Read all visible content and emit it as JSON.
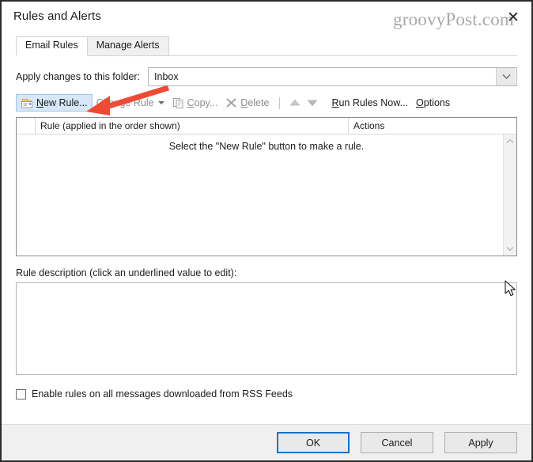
{
  "window": {
    "title": "Rules and Alerts",
    "close_icon": "close-icon",
    "watermark": "groovyPost.com"
  },
  "tabs": [
    {
      "label": "Email Rules",
      "active": true
    },
    {
      "label": "Manage Alerts",
      "active": false
    }
  ],
  "folder": {
    "label": "Apply changes to this folder:",
    "value": "Inbox",
    "dropdown_icon": "chevron-down-icon"
  },
  "toolbar": {
    "new_rule": {
      "label": "New Rule...",
      "icon": "new-rule-icon",
      "highlighted": true
    },
    "change_rule": {
      "label": "Change Rule",
      "icon": "chevron-down-icon",
      "disabled": true
    },
    "copy": {
      "label": "Copy...",
      "icon": "copy-icon",
      "disabled": true
    },
    "delete": {
      "label": "Delete",
      "icon": "delete-x-icon",
      "disabled": true
    },
    "move_up": {
      "icon": "arrow-up-icon"
    },
    "move_down": {
      "icon": "arrow-down-icon"
    },
    "run_rules_now": {
      "label": "Run Rules Now..."
    },
    "options": {
      "label": "Options"
    }
  },
  "rules_list": {
    "columns": [
      "Rule (applied in the order shown)",
      "Actions"
    ],
    "rows": [],
    "empty_message": "Select the \"New Rule\" button to make a rule.",
    "scrollbar": {
      "up_icon": "chevron-up-icon",
      "down_icon": "chevron-down-icon"
    }
  },
  "description": {
    "label": "Rule description (click an underlined value to edit):",
    "value": ""
  },
  "rss_checkbox": {
    "label": "Enable rules on all messages downloaded from RSS Feeds",
    "checked": false
  },
  "footer": {
    "ok": "OK",
    "cancel": "Cancel",
    "apply": "Apply"
  },
  "annotations": {
    "arrow_color": "#ef4a34",
    "arrow_target": "new-rule-button"
  },
  "colors": {
    "accent": "#1474c4",
    "highlight": "#d6e8f7",
    "window_border": "#2b2b2b"
  }
}
